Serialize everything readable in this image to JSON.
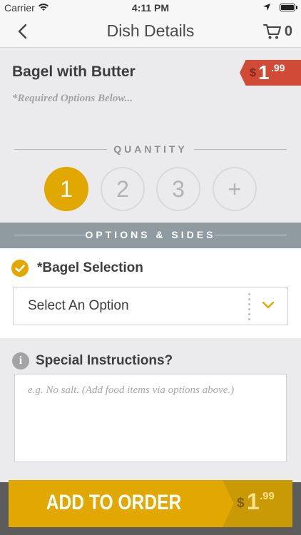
{
  "status_bar": {
    "carrier": "Carrier",
    "time": "4:11 PM"
  },
  "nav": {
    "title": "Dish Details",
    "cart_count": "0"
  },
  "item": {
    "name": "Bagel with Butter",
    "price_currency": "$",
    "price_whole": "1",
    "price_cents": ".99",
    "required_note": "*Required Options Below..."
  },
  "quantity": {
    "label": "QUANTITY",
    "options": [
      "1",
      "2",
      "3",
      "+"
    ],
    "selected": "1"
  },
  "options_bar": {
    "label": "OPTIONS & SIDES"
  },
  "bagel_selection": {
    "title": "*Bagel Selection",
    "dropdown_value": "Select An Option"
  },
  "instructions": {
    "title": "Special Instructions?",
    "info_glyph": "i",
    "placeholder": "e.g. No salt. (Add food items via options above.)"
  },
  "add_button": {
    "label": "ADD TO ORDER",
    "price_currency": "$",
    "price_whole": "1",
    "price_cents": ".99"
  },
  "colors": {
    "accent": "#e0a800",
    "price_tag": "#d04a36",
    "section_bar": "#8f9ba1"
  }
}
